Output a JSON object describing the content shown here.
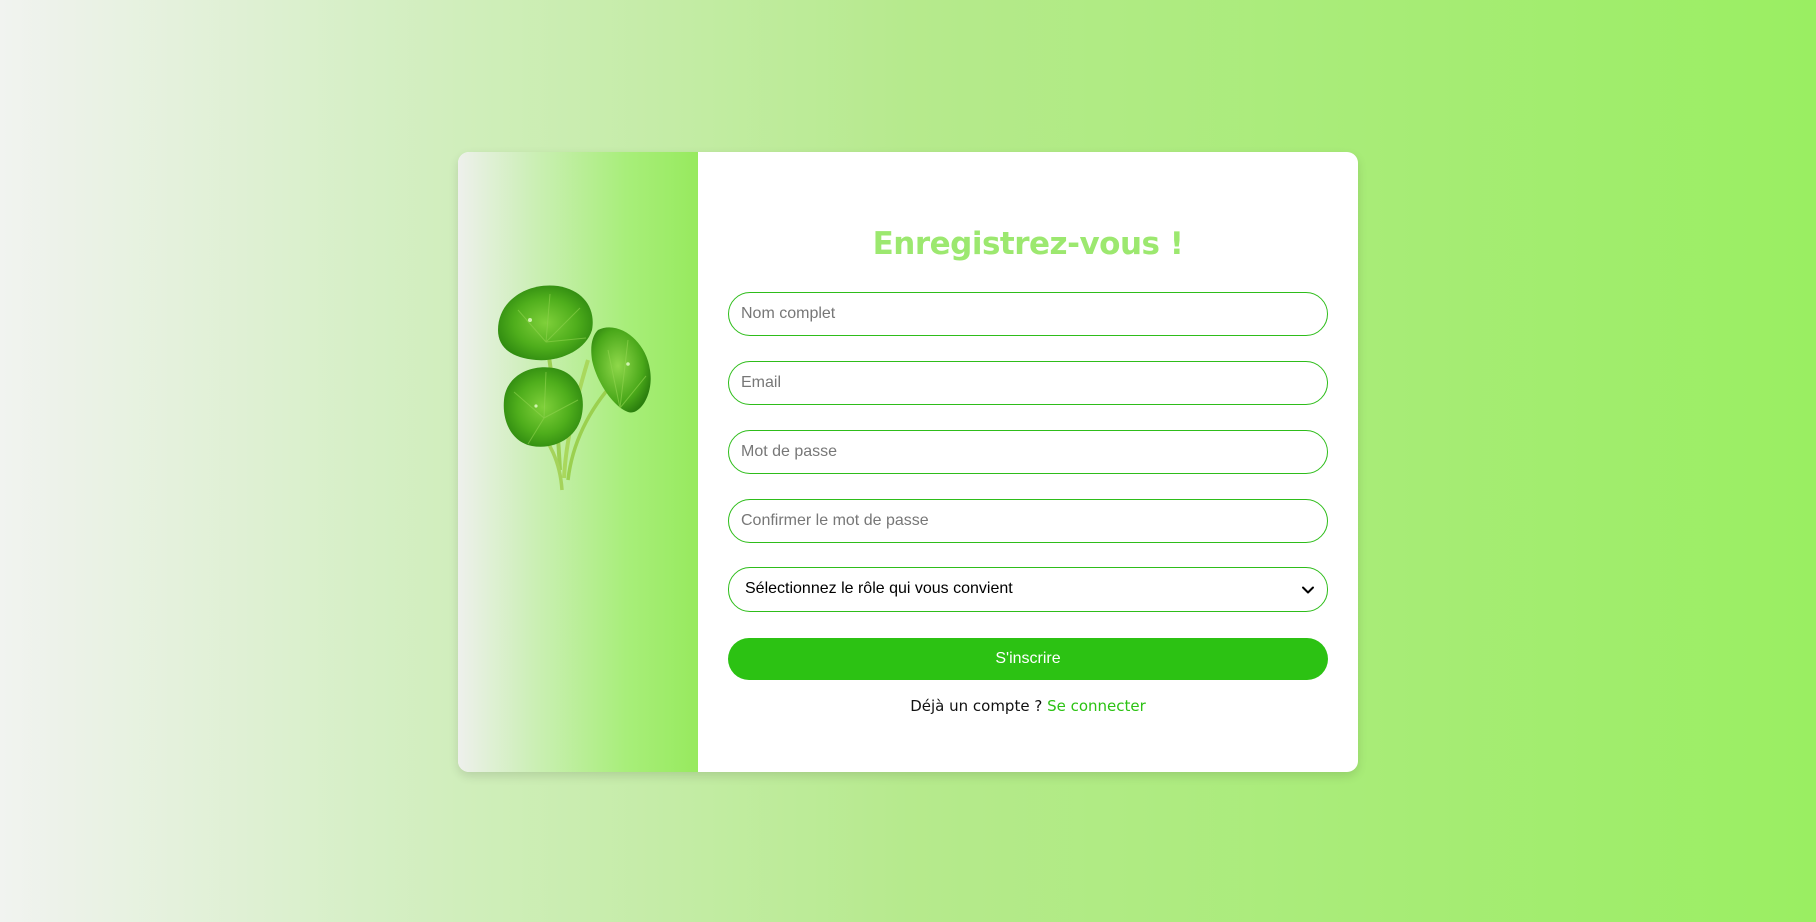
{
  "form": {
    "title": "Enregistrez-vous !",
    "fields": {
      "full_name": {
        "placeholder": "Nom complet",
        "value": ""
      },
      "email": {
        "placeholder": "Email",
        "value": ""
      },
      "password": {
        "placeholder": "Mot de passe",
        "value": ""
      },
      "confirm_password": {
        "placeholder": "Confirmer le mot de passe",
        "value": ""
      }
    },
    "role_select": {
      "selected": "Sélectionnez le rôle qui vous convient"
    },
    "submit_label": "S'inscrire",
    "login_prompt": "Déjà un compte ?",
    "login_link": "Se connecter"
  },
  "colors": {
    "accent": "#2cc213",
    "title": "#9ce86f",
    "background_end": "#9aee62"
  },
  "icons": {
    "illustration": "centella-leaves-image",
    "select_arrow": "chevron-down-icon"
  }
}
